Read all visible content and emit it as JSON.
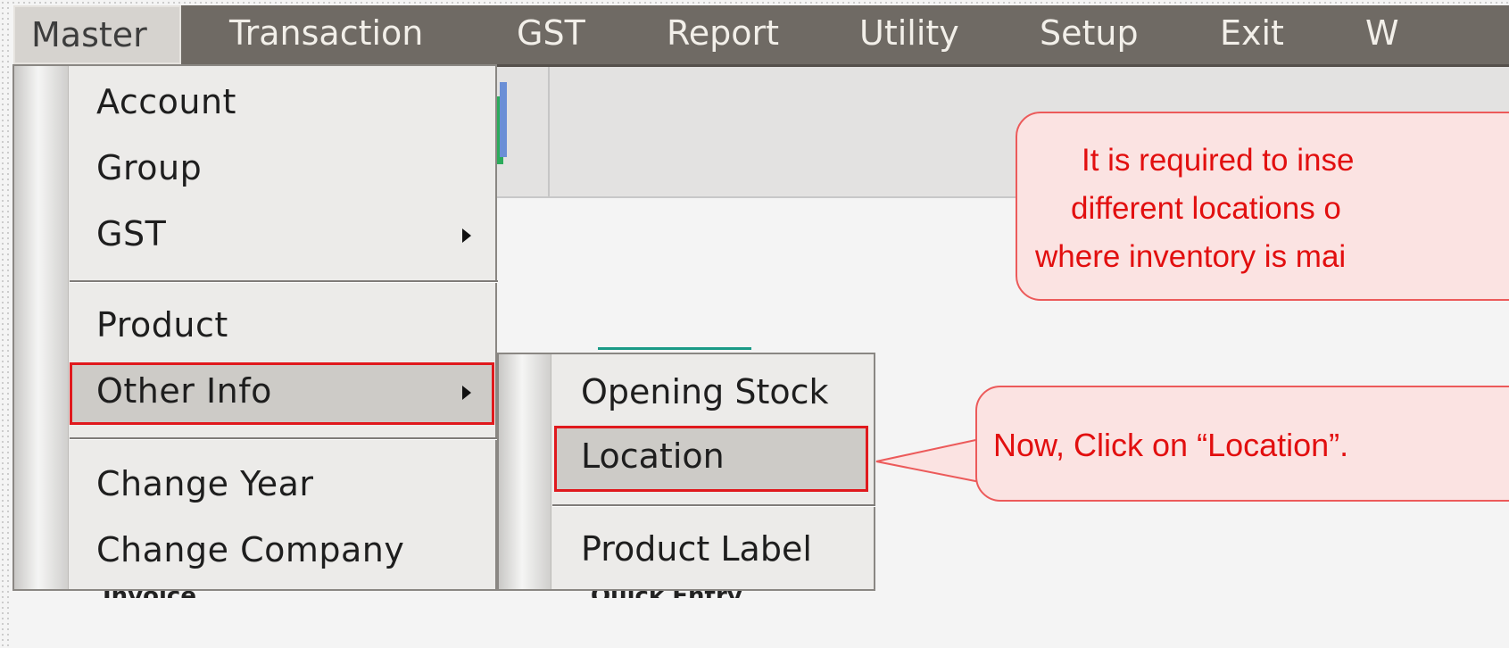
{
  "menubar": {
    "items": [
      {
        "label": "Master",
        "mnemonic": "M"
      },
      {
        "label": "Transaction",
        "mnemonic": "T"
      },
      {
        "label": "GST",
        "mnemonic": "G"
      },
      {
        "label": "Report",
        "mnemonic": "R"
      },
      {
        "label": "Utility",
        "mnemonic": "U"
      },
      {
        "label": "Setup",
        "mnemonic": "S"
      },
      {
        "label": "Exit",
        "mnemonic": "E"
      },
      {
        "label": "W",
        "mnemonic": "W"
      }
    ]
  },
  "master_menu": {
    "items": [
      {
        "label": "Account"
      },
      {
        "label": "Group"
      },
      {
        "label": "GST"
      },
      {
        "label": "Product"
      },
      {
        "label": "Other Info"
      },
      {
        "label": "Change Year"
      },
      {
        "label": "Change Company"
      }
    ]
  },
  "other_info_menu": {
    "items": [
      {
        "label": "Opening Stock"
      },
      {
        "label": "Location"
      },
      {
        "label": "Product Label"
      }
    ]
  },
  "background": {
    "label_left": "Invoice",
    "label_right": "Quick Entry"
  },
  "callouts": {
    "info_lines": [
      "It is required to inse",
      "different locations o",
      "where inventory is mai"
    ],
    "instruction": "Now, Click on “Location”."
  },
  "colors": {
    "menubar": "#6f6a64",
    "highlight_border": "#e0191d",
    "callout_fill": "#fbe3e2",
    "callout_text": "#e20f0f"
  }
}
